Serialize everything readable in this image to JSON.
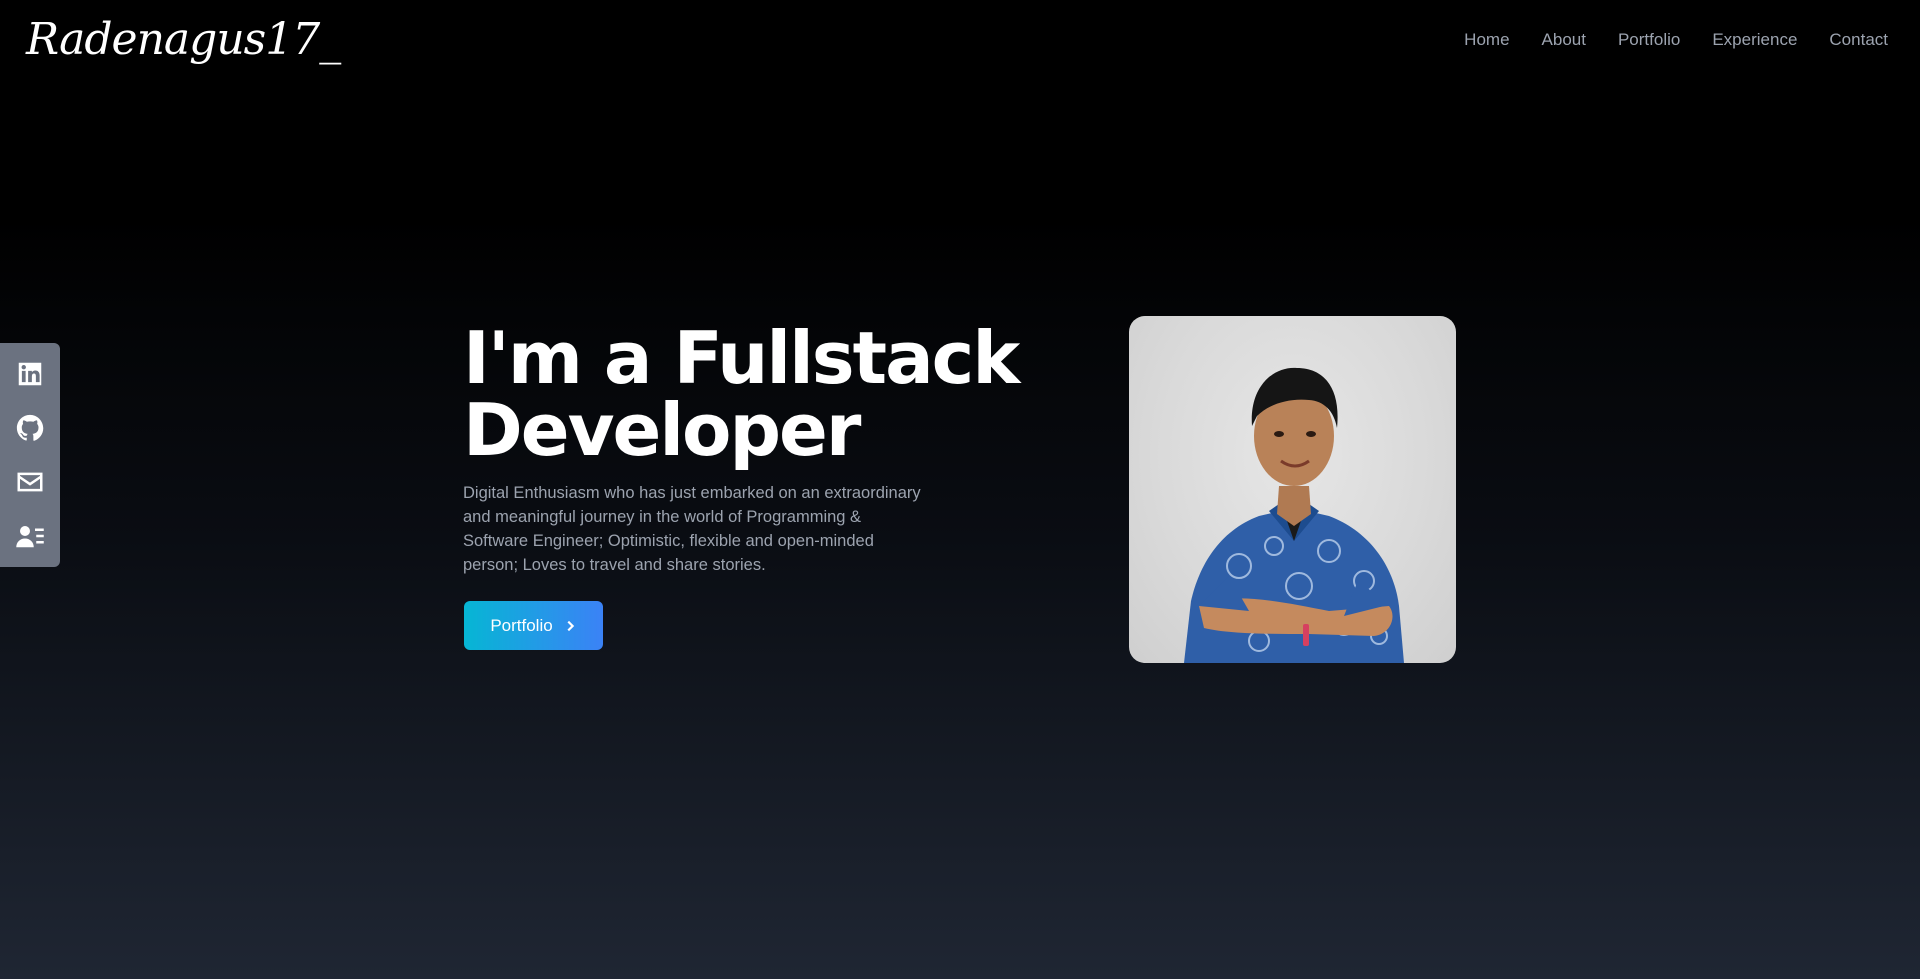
{
  "header": {
    "logo": "Radenagus17_",
    "nav": [
      "Home",
      "About",
      "Portfolio",
      "Experience",
      "Contact"
    ]
  },
  "social": {
    "icons": [
      "linkedin-icon",
      "github-icon",
      "mail-icon",
      "resume-icon"
    ]
  },
  "hero": {
    "title": "I'm a Fullstack Developer",
    "description": "Digital Enthusiasm who has just embarked on an extraordinary and meaningful journey in the world of Programming & Software Engineer; Optimistic, flexible and open-minded person; Loves to travel and share stories.",
    "cta_label": "Portfolio"
  },
  "colors": {
    "accent_start": "#06b6d4",
    "accent_end": "#3b82f6",
    "nav_text": "#9ca3af",
    "social_bar": "#6b7280"
  }
}
